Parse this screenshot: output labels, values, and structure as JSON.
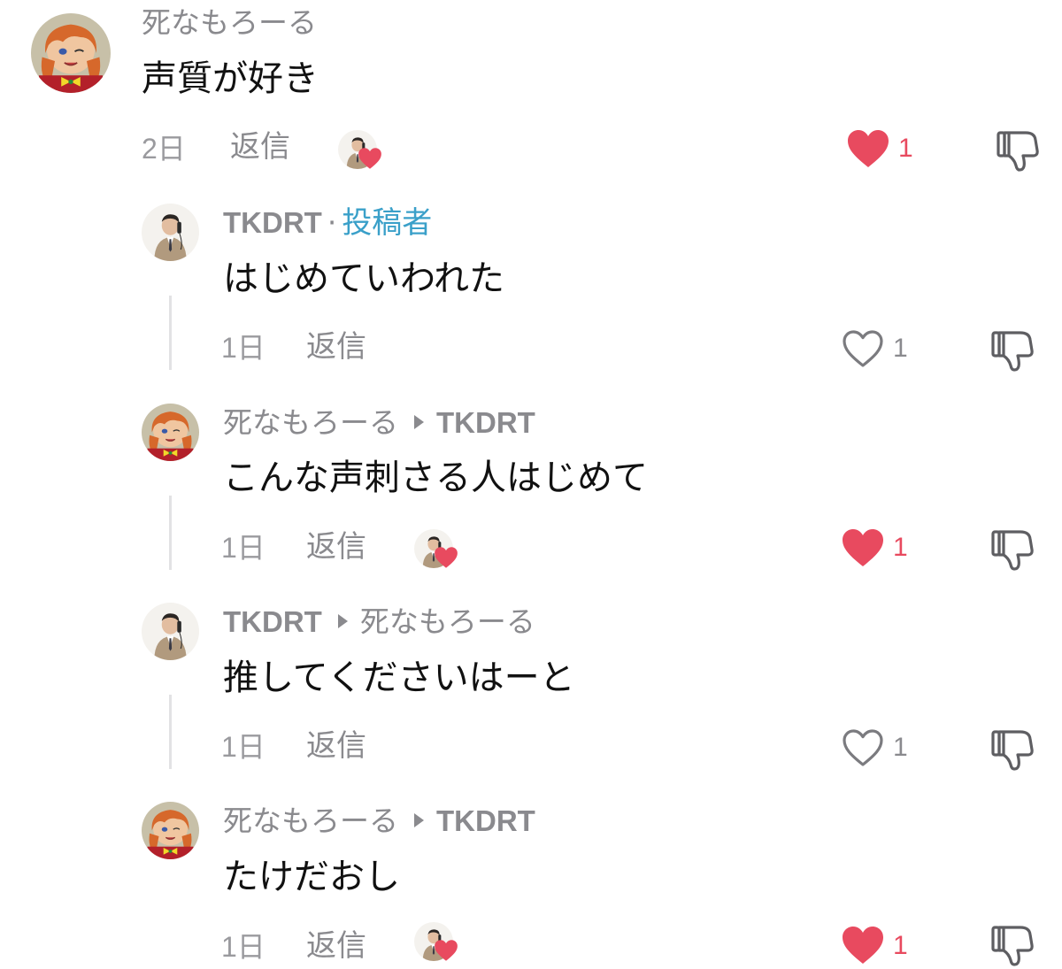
{
  "comments": [
    {
      "user": "死なもろーる",
      "text": "声質が好き",
      "age": "2日",
      "reply_label": "返信",
      "liked_by_author": true,
      "liked": true,
      "likes": "1"
    },
    {
      "user": "TKDRT",
      "author_separator": "·",
      "author_tag": "投稿者",
      "text": "はじめていわれた",
      "age": "1日",
      "reply_label": "返信",
      "liked_by_author": false,
      "liked": false,
      "likes": "1"
    },
    {
      "user": "死なもろーる",
      "reply_to": "TKDRT",
      "text": "こんな声刺さる人はじめて",
      "age": "1日",
      "reply_label": "返信",
      "liked_by_author": true,
      "liked": true,
      "likes": "1"
    },
    {
      "user": "TKDRT",
      "reply_to": "死なもろーる",
      "text": "推してくださいはーと",
      "age": "1日",
      "reply_label": "返信",
      "liked_by_author": false,
      "liked": false,
      "likes": "1"
    },
    {
      "user": "死なもろーる",
      "reply_to": "TKDRT",
      "text": "たけだおし",
      "age": "1日",
      "reply_label": "返信",
      "liked_by_author": true,
      "liked": true,
      "likes": "1"
    }
  ],
  "colors": {
    "like_red": "#e84a5f",
    "author_tag_blue": "#3aa0c9",
    "meta_gray": "#8a8a8e",
    "text_black": "#111111"
  },
  "icons": {
    "like": "heart-icon",
    "dislike": "thumbs-down-icon",
    "reply_arrow": "triangle-right-icon",
    "creator_liked": "creator-liked-heart-icon"
  }
}
